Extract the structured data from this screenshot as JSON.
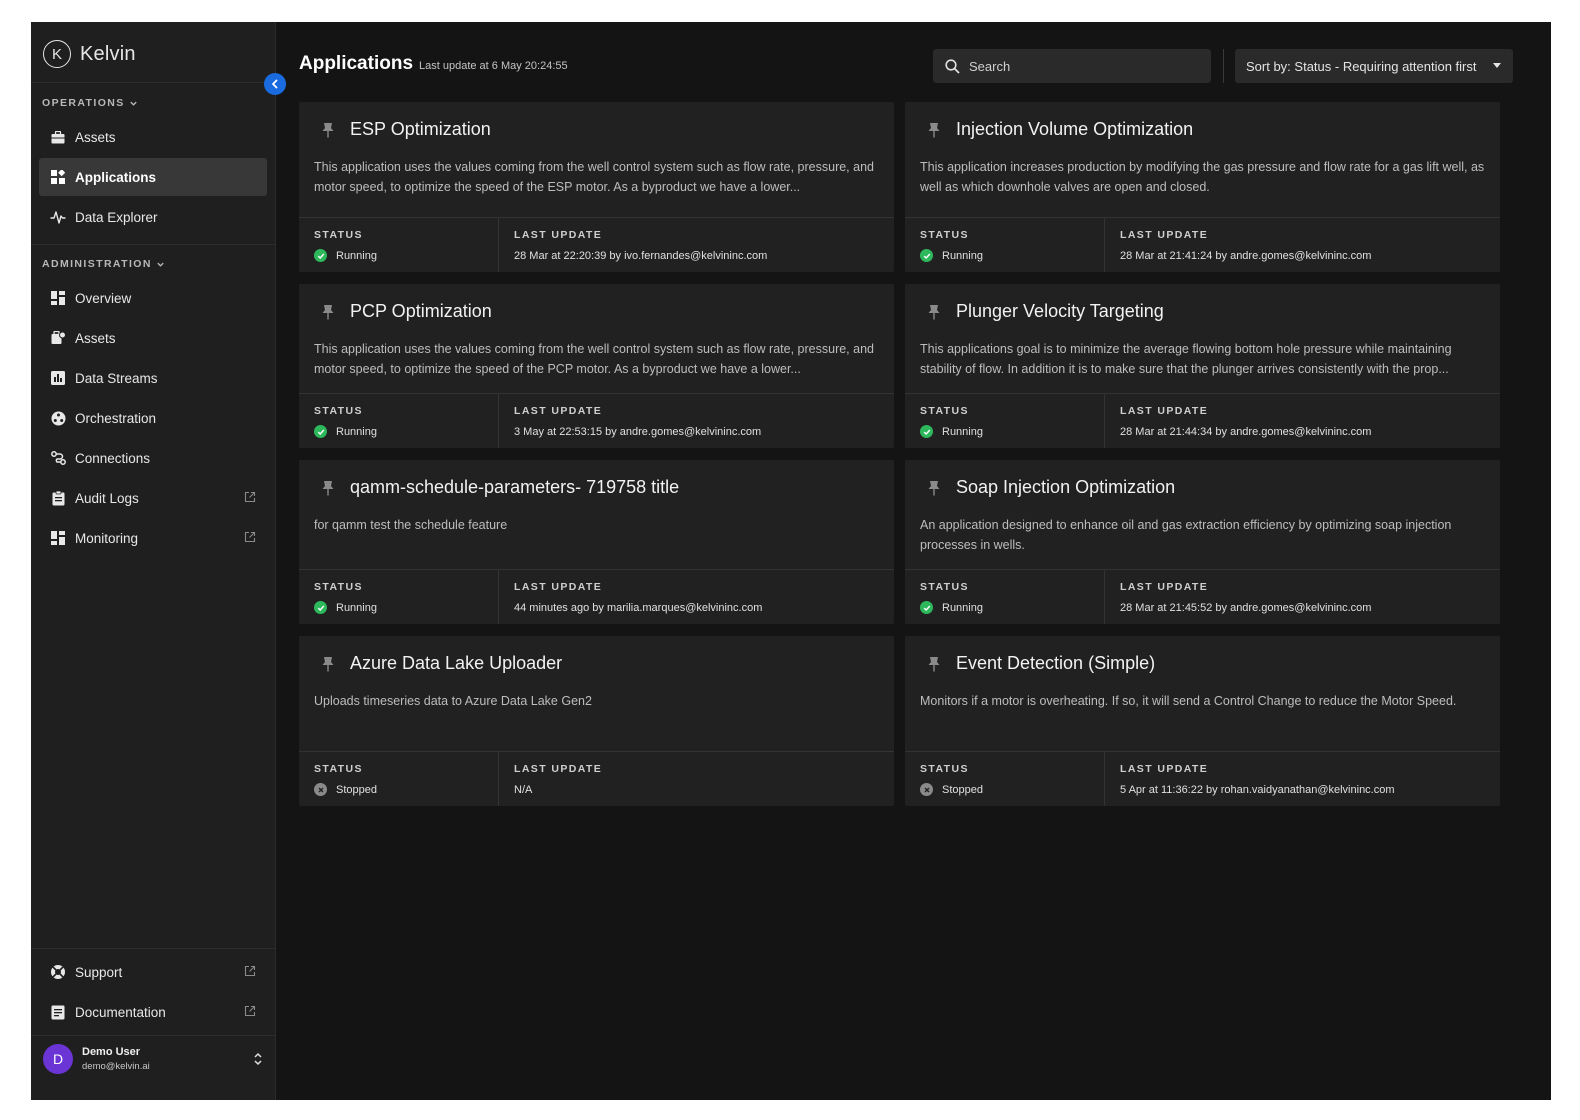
{
  "app": {
    "logo_text": "Kelvin"
  },
  "sidebar": {
    "operations_title": "OPERATIONS",
    "operations": [
      {
        "label": "Assets"
      },
      {
        "label": "Applications",
        "active": true
      },
      {
        "label": "Data Explorer"
      }
    ],
    "administration_title": "ADMINISTRATION",
    "administration": [
      {
        "label": "Overview"
      },
      {
        "label": "Assets"
      },
      {
        "label": "Data Streams"
      },
      {
        "label": "Orchestration"
      },
      {
        "label": "Connections"
      },
      {
        "label": "Audit Logs"
      },
      {
        "label": "Monitoring"
      }
    ],
    "bottom": [
      {
        "label": "Support"
      },
      {
        "label": "Documentation"
      }
    ],
    "user": {
      "initial": "D",
      "name": "Demo User",
      "email": "demo@kelvin.ai"
    }
  },
  "header": {
    "title": "Applications",
    "last_update": "Last update at 6 May 20:24:55",
    "search_placeholder": "Search",
    "sort_label": "Sort by: Status - Requiring attention first"
  },
  "labels": {
    "status": "STATUS",
    "last_update": "LAST UPDATE"
  },
  "colors": {
    "accent": "#1a6be0",
    "running": "#2eb85c",
    "stopped": "#8a8a8a",
    "avatar": "#6b35d6"
  },
  "cards": [
    {
      "title": "ESP Optimization",
      "description": "This application uses the values coming from the well control system such as flow rate, pressure, and motor speed, to optimize the speed of the ESP motor. As a byproduct we have a lower...",
      "status": "Running",
      "last_update": "28 Mar at 22:20:39 by ivo.fernandes@kelvininc.com"
    },
    {
      "title": "Injection Volume Optimization",
      "description": "This application increases production by modifying the gas pressure and flow rate for a gas lift well, as well as which downhole valves are open and closed.",
      "status": "Running",
      "last_update": "28 Mar at 21:41:24 by andre.gomes@kelvininc.com"
    },
    {
      "title": "PCP Optimization",
      "description": "This application uses the values coming from the well control system such as flow rate, pressure, and motor speed, to optimize the speed of the PCP motor. As a byproduct we have a lower...",
      "status": "Running",
      "last_update": "3 May at 22:53:15 by andre.gomes@kelvininc.com"
    },
    {
      "title": "Plunger Velocity Targeting",
      "description": "This applications goal is to minimize the average flowing bottom hole pressure while maintaining stability of flow. In addition it is to make sure that the plunger arrives consistently with the prop...",
      "status": "Running",
      "last_update": "28 Mar at 21:44:34 by andre.gomes@kelvininc.com"
    },
    {
      "title": "qamm-schedule-parameters- 719758 title",
      "description": "for qamm test the schedule feature",
      "status": "Running",
      "last_update": "44 minutes ago by marilia.marques@kelvininc.com"
    },
    {
      "title": "Soap Injection Optimization",
      "description": "An application designed to enhance oil and gas extraction efficiency by optimizing soap injection processes in wells.",
      "status": "Running",
      "last_update": "28 Mar at 21:45:52 by andre.gomes@kelvininc.com"
    },
    {
      "title": "Azure Data Lake Uploader",
      "description": "Uploads timeseries data to Azure Data Lake Gen2",
      "status": "Stopped",
      "last_update": "N/A"
    },
    {
      "title": "Event Detection (Simple)",
      "description": "Monitors if a motor is overheating. If so, it will send a Control Change to reduce the Motor Speed.",
      "status": "Stopped",
      "last_update": "5 Apr at 11:36:22 by rohan.vaidyanathan@kelvininc.com"
    }
  ]
}
